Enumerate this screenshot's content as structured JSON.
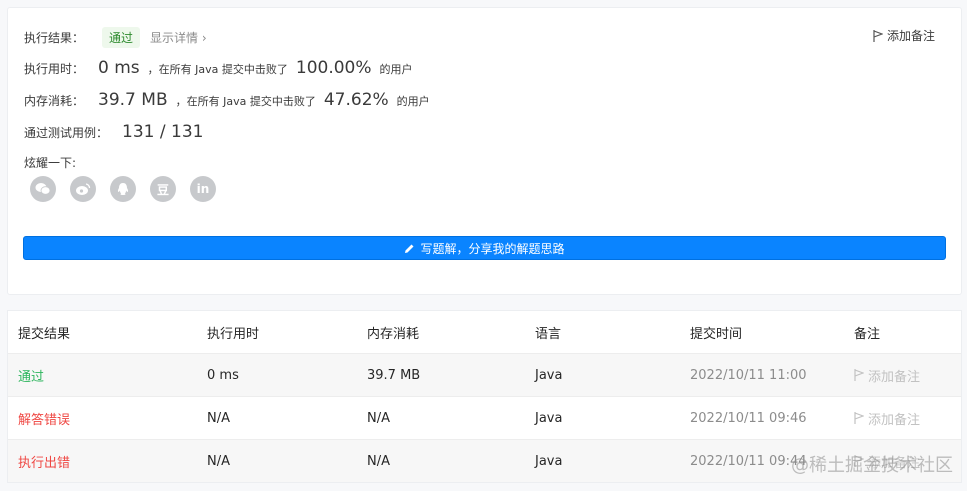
{
  "result": {
    "exec_result_label": "执行结果：",
    "status": "通过",
    "detail_link": "显示详情 ›",
    "add_remark": "添加备注"
  },
  "runtime": {
    "label": "执行用时：",
    "value": "0 ms",
    "prefix": "，在所有 Java 提交中击败了",
    "percent": "100.00%",
    "suffix": "的用户"
  },
  "memory": {
    "label": "内存消耗：",
    "value": "39.7 MB",
    "prefix": "，在所有 Java 提交中击败了",
    "percent": "47.62%",
    "suffix": "的用户"
  },
  "tests": {
    "label": "通过测试用例：",
    "value": "131 / 131"
  },
  "share": {
    "label": "炫耀一下:",
    "icons": [
      "wechat-icon",
      "weibo-icon",
      "qq-icon",
      "douban-icon",
      "linkedin-icon"
    ],
    "douban_glyph": "豆",
    "linkedin_glyph": "in"
  },
  "write_button": "写题解，分享我的解题思路",
  "table": {
    "headers": [
      "提交结果",
      "执行用时",
      "内存消耗",
      "语言",
      "提交时间",
      "备注"
    ],
    "rows": [
      {
        "result": "通过",
        "time": "0 ms",
        "memory": "39.7 MB",
        "lang": "Java",
        "submitted": "2022/10/11 11:00",
        "remark": "添加备注"
      },
      {
        "result": "解答错误",
        "time": "N/A",
        "memory": "N/A",
        "lang": "Java",
        "submitted": "2022/10/11 09:46",
        "remark": "添加备注"
      },
      {
        "result": "执行出错",
        "time": "N/A",
        "memory": "N/A",
        "lang": "Java",
        "submitted": "2022/10/11 09:44",
        "remark": "添加备注"
      }
    ]
  },
  "watermark": "@稀土掘金技术社区",
  "colors": {
    "accent": "#0a84ff",
    "pass": "#2db55d",
    "error": "#ef4743"
  }
}
